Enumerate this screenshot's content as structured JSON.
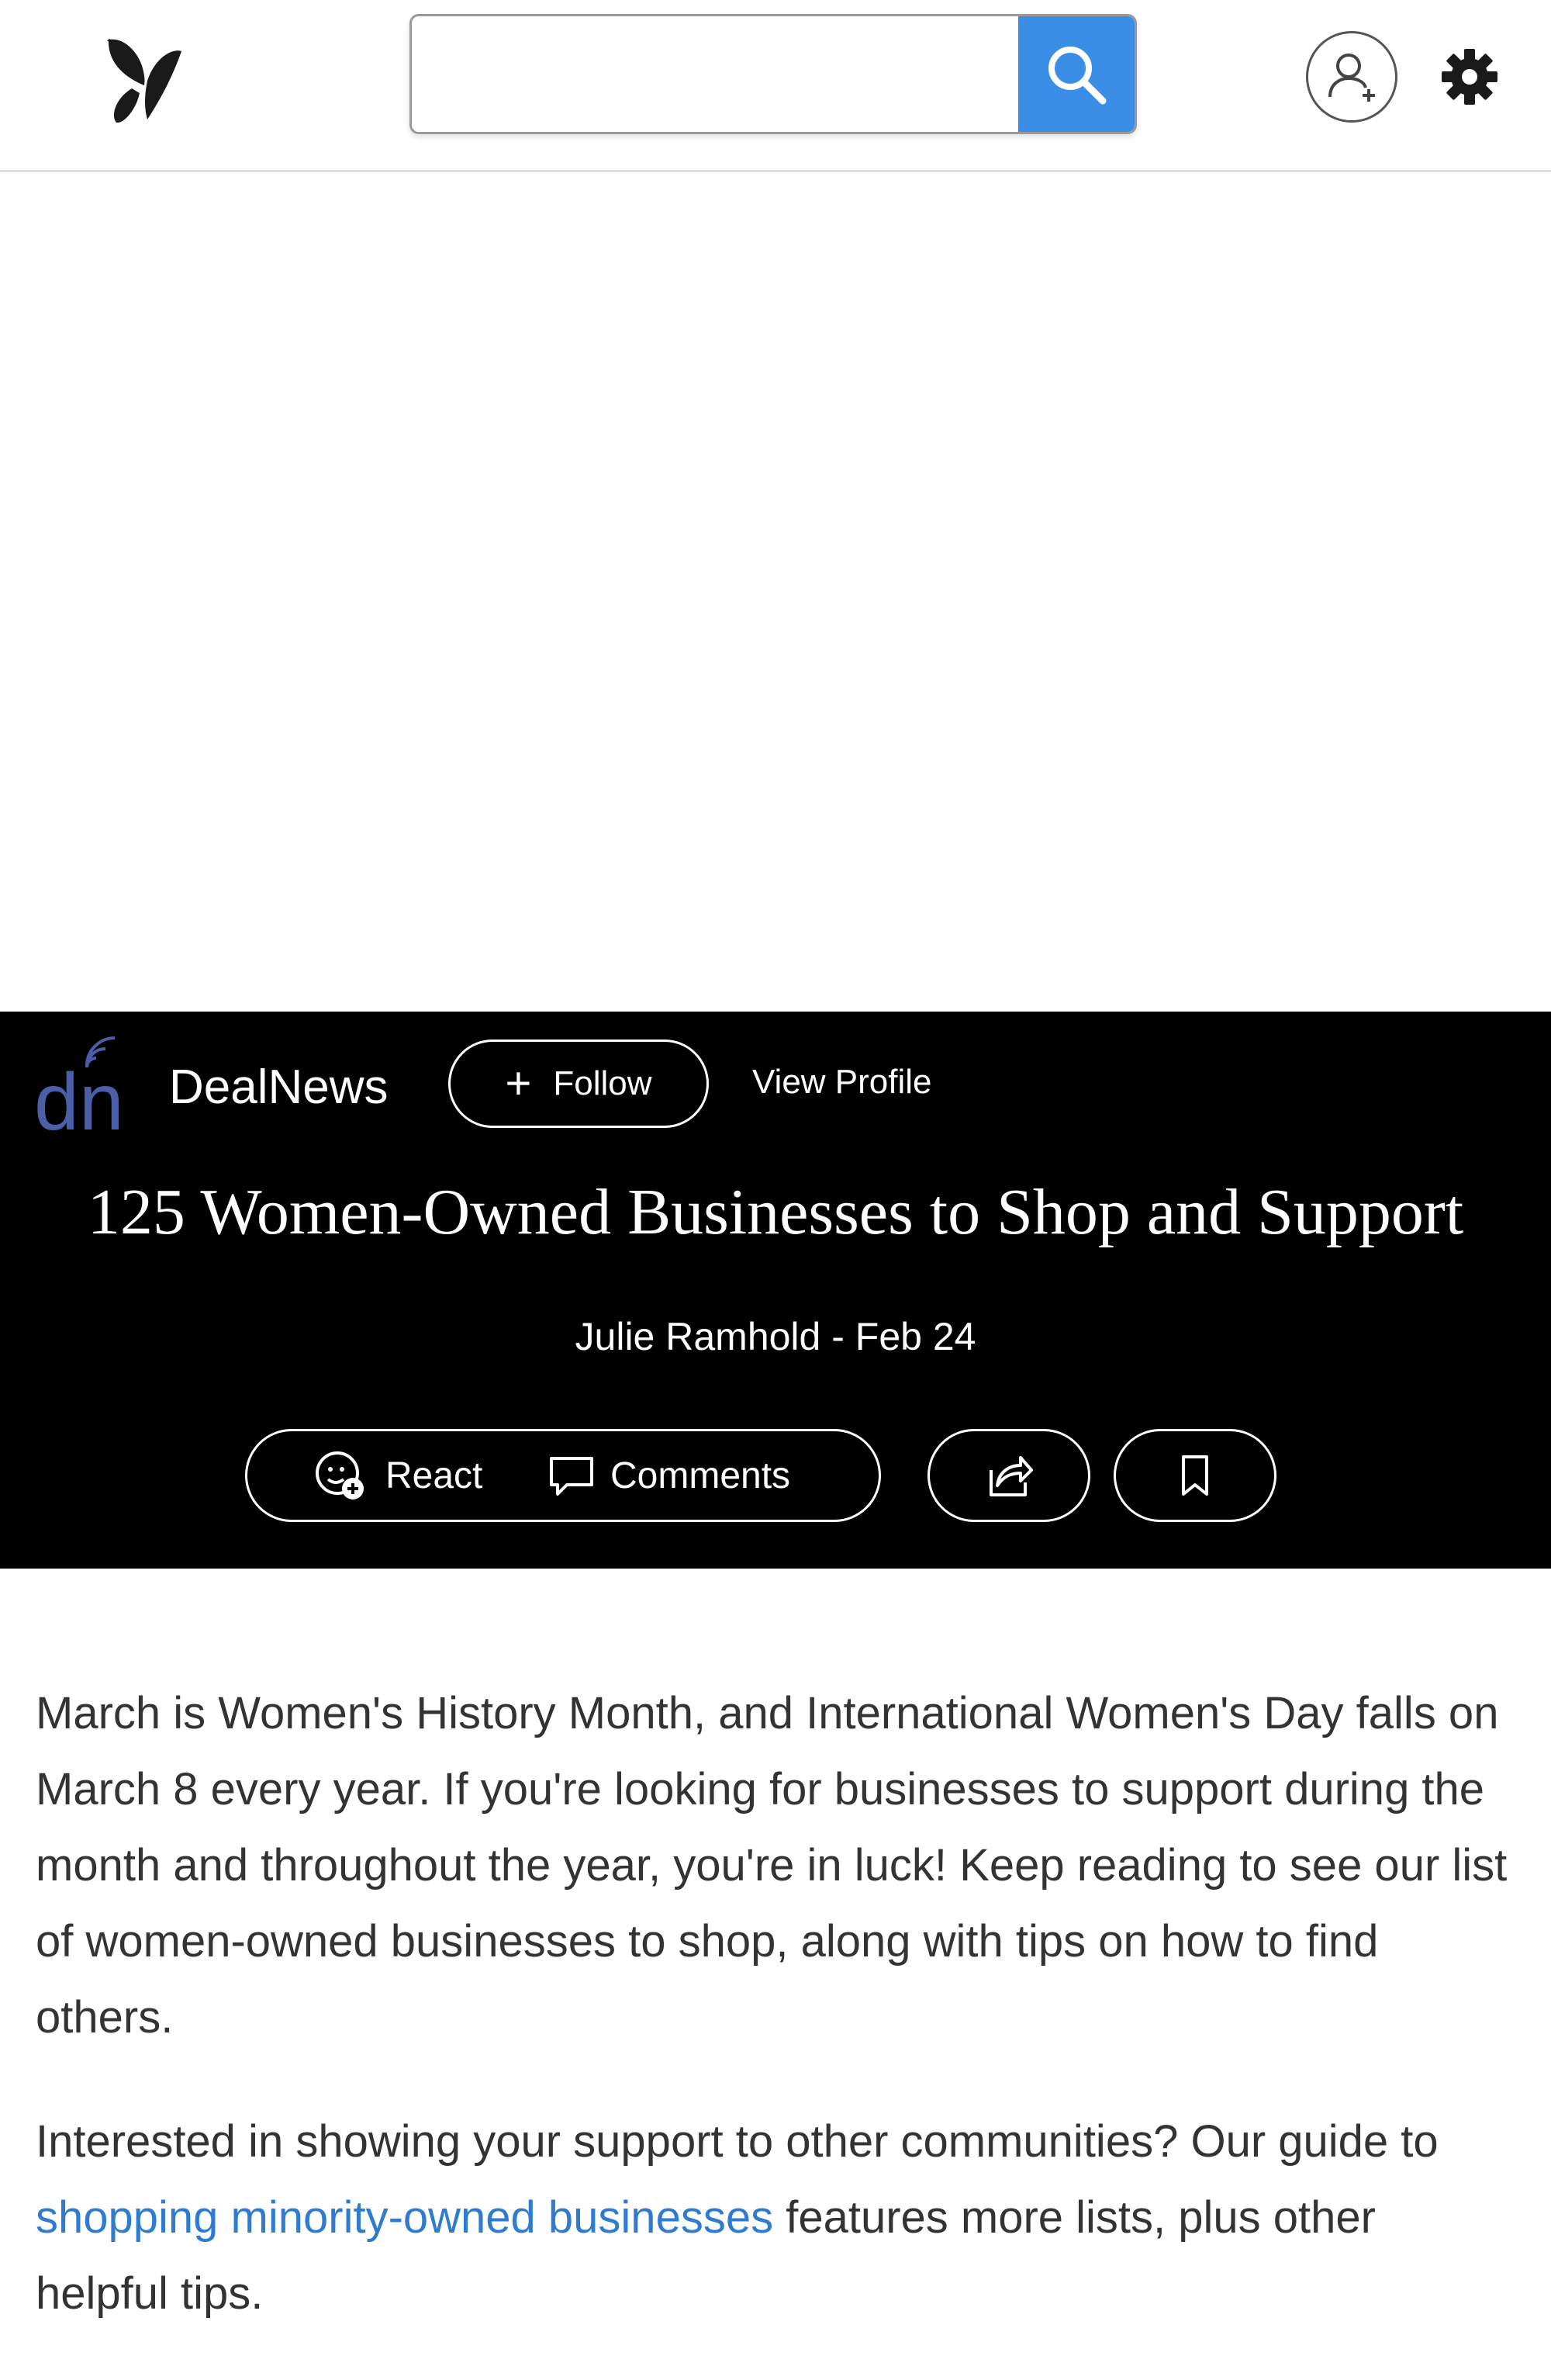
{
  "header": {
    "search": {
      "value": "",
      "placeholder": ""
    }
  },
  "publisher": {
    "name": "DealNews",
    "follow_label": "Follow",
    "view_profile_label": "View Profile"
  },
  "article": {
    "title": "125 Women-Owned Businesses to Shop and Support",
    "byline": "Julie Ramhold - Feb 24",
    "actions": {
      "react_label": "React",
      "comments_label": "Comments"
    },
    "paragraph1": "March is Women's History Month, and International Women's Day falls on March 8 every year. If you're looking for businesses to support during the month and throughout the year, you're in luck! Keep reading to see our list of women-owned businesses to shop, along with tips on how to find others.",
    "paragraph2": {
      "before": "Interested in showing your support to other communities? Our guide to ",
      "link": "shopping minority-owned businesses",
      "after": " features more lists, plus other helpful tips."
    }
  },
  "colors": {
    "search_button": "#3a8ee6",
    "hero_background": "#000000",
    "link": "#2f7bcf",
    "publisher_logo": "#4a5fa8"
  },
  "icons": {
    "logo": "butterfly-logo-icon",
    "search": "magnifier-icon",
    "profile": "add-user-icon",
    "settings": "gear-icon",
    "react": "emoji-add-icon",
    "comments": "speech-bubble-icon",
    "share": "share-icon",
    "save": "bookmark-icon"
  }
}
